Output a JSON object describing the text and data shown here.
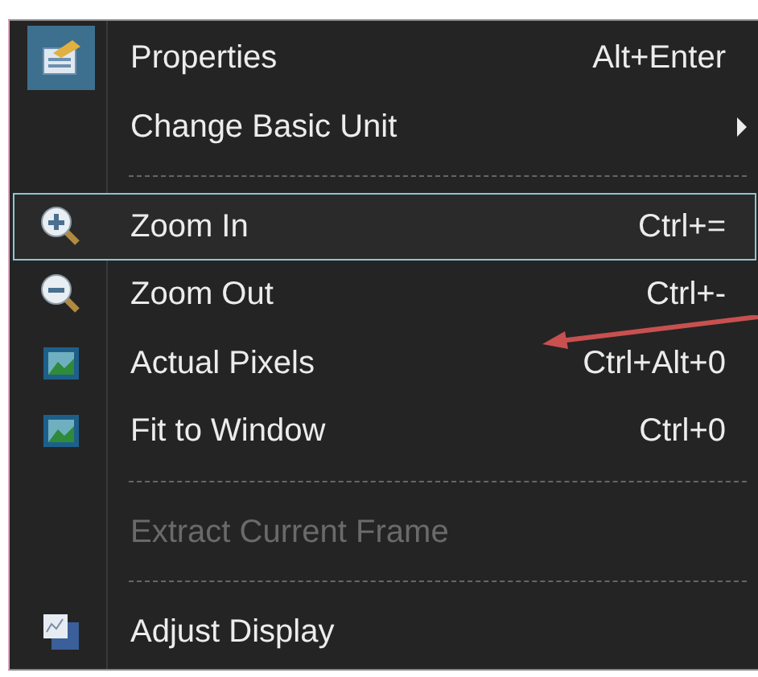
{
  "menu": {
    "items": [
      {
        "kind": "item",
        "label": "Properties",
        "shortcut": "Alt+Enter",
        "submenu": false,
        "selected": false,
        "disabled": false
      },
      {
        "kind": "item",
        "label": "Change Basic Unit",
        "submenu": true,
        "selected": false,
        "disabled": false
      },
      {
        "kind": "separator"
      },
      {
        "kind": "item",
        "label": "Zoom In",
        "shortcut": "Ctrl+=",
        "submenu": false,
        "selected": true,
        "disabled": false
      },
      {
        "kind": "item",
        "label": "Zoom Out",
        "shortcut": "Ctrl+-",
        "submenu": false,
        "selected": false,
        "disabled": false
      },
      {
        "kind": "item",
        "label": "Actual Pixels",
        "shortcut": "Ctrl+Alt+0",
        "submenu": false,
        "selected": false,
        "disabled": false
      },
      {
        "kind": "item",
        "label": "Fit to Window",
        "shortcut": "Ctrl+0",
        "submenu": false,
        "selected": false,
        "disabled": false
      },
      {
        "kind": "separator"
      },
      {
        "kind": "item",
        "label": "Extract Current Frame",
        "submenu": false,
        "selected": false,
        "disabled": true
      },
      {
        "kind": "separator"
      },
      {
        "kind": "item",
        "label": "Adjust Display",
        "submenu": false,
        "selected": false,
        "disabled": false
      }
    ]
  }
}
